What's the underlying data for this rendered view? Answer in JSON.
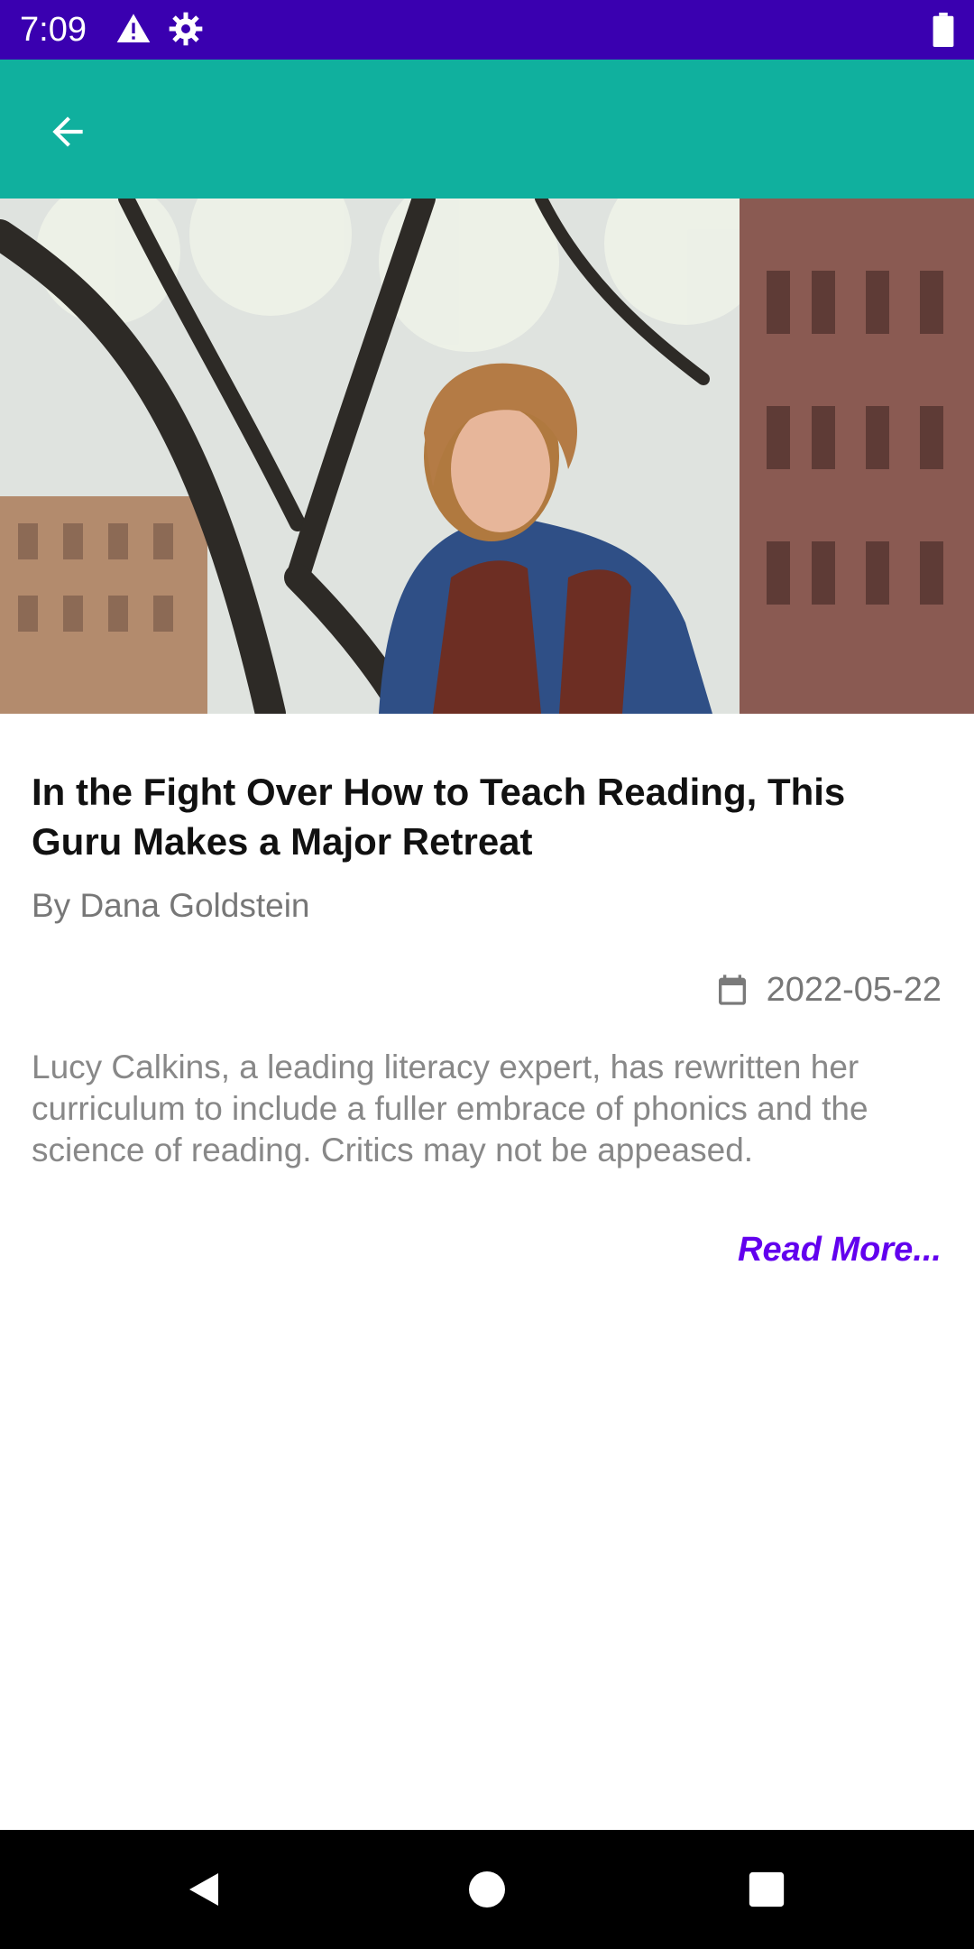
{
  "status_bar": {
    "time": "7:09",
    "icons": [
      "warning-icon",
      "settings-icon",
      "battery-icon"
    ],
    "background": "#3a00b0"
  },
  "app_bar": {
    "background": "#10b09e",
    "back_icon": "arrow-left-icon"
  },
  "article": {
    "title": "In the Fight Over How to Teach Reading, This Guru Makes a Major Retreat",
    "byline": "By Dana Goldstein",
    "date_icon": "calendar-icon",
    "date": "2022-05-22",
    "summary": "Lucy Calkins, a leading literacy expert, has rewritten her curriculum to include a fuller embrace of phonics and the science of reading. Critics may not be appeased.",
    "read_more": "Read More...",
    "accent": "#6200ee"
  },
  "nav_bar": {
    "buttons": [
      "back-triangle-icon",
      "home-circle-icon",
      "recents-square-icon"
    ]
  }
}
